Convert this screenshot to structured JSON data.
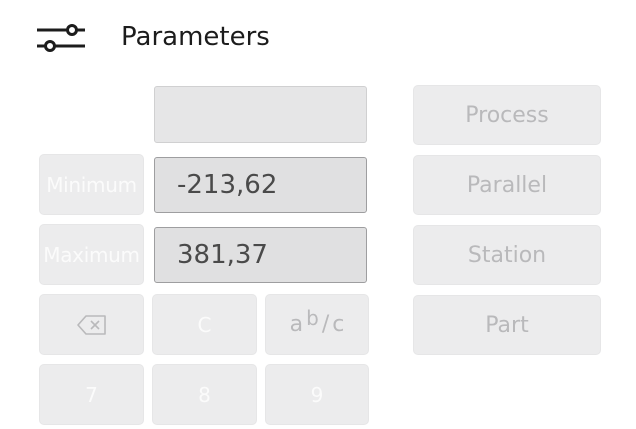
{
  "header": {
    "title": "Parameters",
    "icon": "sliders-icon"
  },
  "fields": {
    "top_value": "",
    "minimum_label": "Minimum",
    "minimum_value": "-213,62",
    "maximum_label": "Maximum",
    "maximum_value": "381,37"
  },
  "keypad": {
    "backspace_icon": "backspace-icon",
    "clear": "C",
    "fraction_a": "a",
    "fraction_b": "b",
    "fraction_sep": "/",
    "fraction_c": "c",
    "seven": "7",
    "eight": "8",
    "nine": "9"
  },
  "actions": {
    "process": "Process",
    "parallel": "Parallel",
    "station": "Station",
    "part": "Part"
  },
  "colors": {
    "button_bg": "#ececed",
    "field_bg": "#e0e0e1",
    "text_dark": "#1c1c1c"
  }
}
